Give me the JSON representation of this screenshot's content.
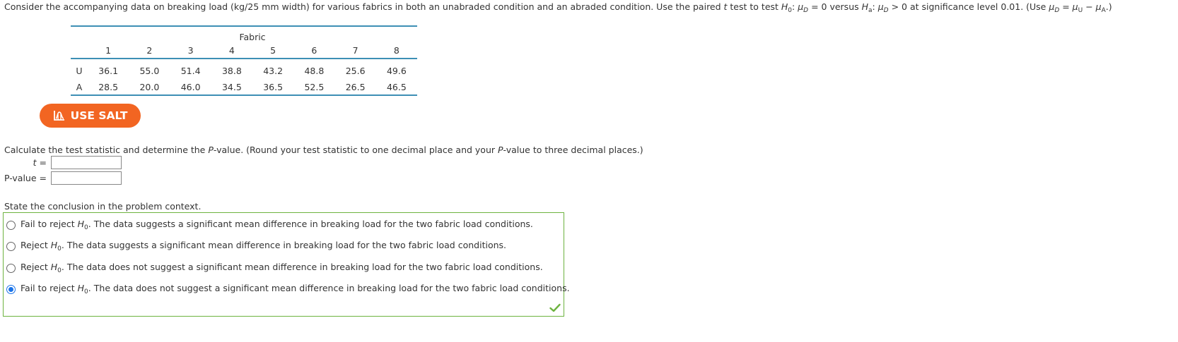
{
  "intro": {
    "part1": "Consider the accompanying data on breaking load (kg/25 mm width) for various fabrics in both an unabraded condition and an abraded condition. Use the paired ",
    "t": "t",
    "part2": " test to test ",
    "H": "H",
    "sub0": "0",
    "colon1": ": ",
    "mu": "μ",
    "subD": "D",
    "eq0": " = 0 versus ",
    "subA": "a",
    "gt0": " > 0 at significance level 0.01. (Use ",
    "eq": " = ",
    "subU": "U",
    "minus": " − ",
    "subAcap": "A",
    "close": ".)"
  },
  "table": {
    "caption": "Fabric",
    "columns": [
      "1",
      "2",
      "3",
      "4",
      "5",
      "6",
      "7",
      "8"
    ],
    "rows": [
      {
        "label": "U",
        "values": [
          "36.1",
          "55.0",
          "51.4",
          "38.8",
          "43.2",
          "48.8",
          "25.6",
          "49.6"
        ]
      },
      {
        "label": "A",
        "values": [
          "28.5",
          "20.0",
          "46.0",
          "34.5",
          "36.5",
          "52.5",
          "26.5",
          "46.5"
        ]
      }
    ]
  },
  "salt_button": {
    "label": "USE SALT",
    "icon": "salt-chart-icon",
    "color": "#f26522"
  },
  "question": {
    "text1": "Calculate the test statistic and determine the ",
    "P": "P",
    "text2": "-value. (Round your test statistic to one decimal place and your ",
    "text3": "-value to three decimal places.)"
  },
  "fields": {
    "t_label": "t",
    "t_eq": " =",
    "t_value": "",
    "p_label": "P-value",
    "p_eq": " =",
    "p_value": ""
  },
  "conclusion": {
    "prompt": "State the conclusion in the problem context.",
    "options": [
      {
        "lead": "Fail to reject",
        "rest": "The data suggests a significant mean difference in breaking load for the two fabric load conditions.",
        "checked": false
      },
      {
        "lead": "Reject",
        "rest": "The data suggests a significant mean difference in breaking load for the two fabric load conditions.",
        "checked": false
      },
      {
        "lead": "Reject",
        "rest": "The data does not suggest a significant mean difference in breaking load for the two fabric load conditions.",
        "checked": false
      },
      {
        "lead": "Fail to reject",
        "rest": "The data does not suggest a significant mean difference in breaking load for the two fabric load conditions.",
        "checked": true
      }
    ],
    "H": "H",
    "sub0": "0",
    "dot": ".",
    "correct_icon": "checkmark-icon",
    "accent": "#6db33f"
  }
}
